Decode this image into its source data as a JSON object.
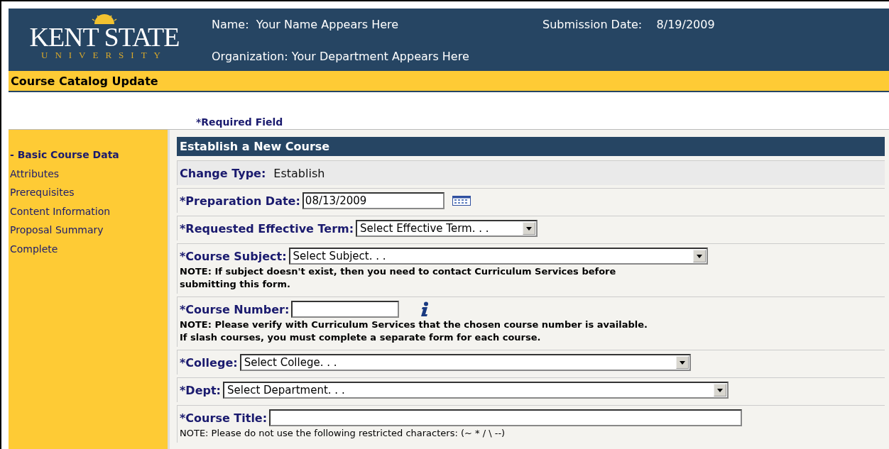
{
  "logo": {
    "wordmark": "KENT STATE",
    "subline": "UNIVERSITY"
  },
  "header": {
    "name_label": "Name:",
    "name_value": "Your Name Appears Here",
    "date_label": "Submission Date:",
    "date_value": "8/19/2009",
    "org_label": "Organization:",
    "org_value": "Your Department Appears Here"
  },
  "title_bar": "Course Catalog Update",
  "required_note": "*Required Field",
  "sidebar": {
    "items": [
      {
        "label": "- Basic Course Data",
        "selected": true
      },
      {
        "label": "Attributes",
        "selected": false
      },
      {
        "label": "Prerequisites",
        "selected": false
      },
      {
        "label": "Content Information",
        "selected": false
      },
      {
        "label": "Proposal Summary",
        "selected": false
      },
      {
        "label": "Complete",
        "selected": false
      }
    ]
  },
  "form": {
    "title": "Establish a New Course",
    "rows": [
      {
        "kind": "static",
        "label": "Change Type:",
        "value": "Establish"
      },
      {
        "kind": "date",
        "label": "*Preparation Date:",
        "value": "08/13/2009"
      },
      {
        "kind": "select",
        "label": "*Requested Effective Term:",
        "value": "Select Effective Term. . ."
      },
      {
        "kind": "select",
        "label": "*Course Subject:",
        "value": "Select Subject. . .",
        "note": [
          "NOTE: If subject doesn't exist, then you need to contact Curriculum Services before",
          "submitting this form."
        ],
        "note_bold": true
      },
      {
        "kind": "text",
        "label": "*Course Number:",
        "info": true,
        "note": [
          "NOTE: Please verify with Curriculum Services that the chosen course number is available.",
          "If slash courses, you must complete a separate form for each course."
        ],
        "note_bold": true
      },
      {
        "kind": "select",
        "label": "*College:",
        "value": "Select College. . ."
      },
      {
        "kind": "select",
        "label": "*Dept:",
        "value": "Select Department. . ."
      },
      {
        "kind": "text",
        "label": "*Course Title:",
        "note": [
          "NOTE: Please do not use the following restricted characters: (~ * / \\ --)"
        ],
        "note_bold": false
      }
    ]
  }
}
